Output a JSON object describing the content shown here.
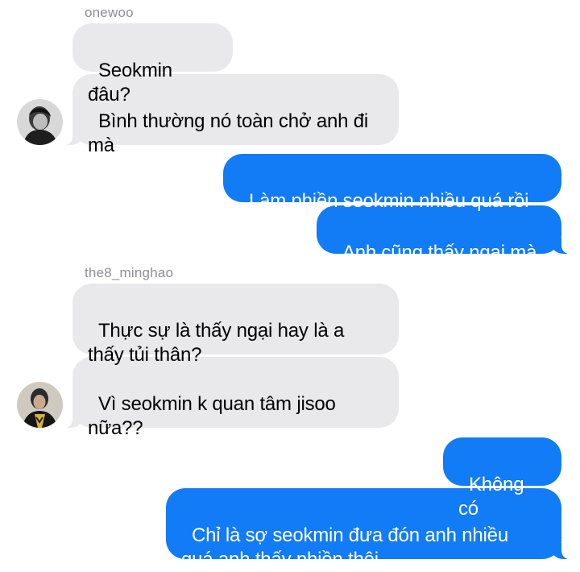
{
  "conversation": {
    "groups": [
      {
        "sender": "onewoo",
        "messages": [
          "Seokmin đâu?",
          "Bình thường nó toàn chở anh đi\nmà"
        ]
      },
      {
        "sender": "me",
        "messages": [
          "Làm phiền seokmin nhiều quá rồi",
          "Anh cũng thấy ngại mà"
        ]
      },
      {
        "sender": "the8_minghao",
        "messages": [
          "Thực sự là thấy ngại hay là a\nthấy tủi thân?",
          "Vì seokmin k quan tâm jisoo\nnữa??"
        ]
      },
      {
        "sender": "me",
        "messages": [
          "Không có",
          "Chỉ là sợ seokmin đưa đón anh nhiều\nquá anh thấy phiền thôi"
        ]
      }
    ]
  },
  "colors": {
    "incoming_bubble": "#e9e9eb",
    "outgoing_bubble": "#127bf6",
    "sender_name": "#8e8e93"
  },
  "icons": {
    "avatar_onewoo": "avatar",
    "avatar_minghao": "avatar"
  }
}
